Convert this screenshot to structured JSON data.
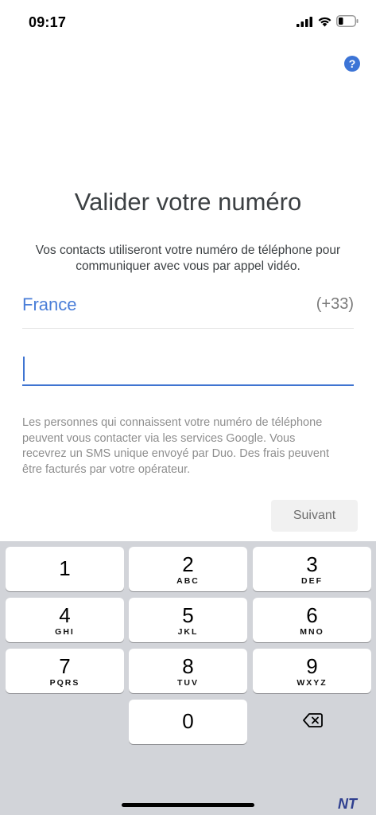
{
  "status_bar": {
    "time": "09:17",
    "icons": [
      "cellular-signal-icon",
      "wifi-icon",
      "battery-icon"
    ]
  },
  "help_icon": "help-icon",
  "title": "Valider votre numéro",
  "description": "Vos contacts utiliseront votre numéro de téléphone pour communiquer avec vous par appel vidéo.",
  "country": {
    "name": "France",
    "code": "(+33)"
  },
  "phone_input": {
    "value": "",
    "placeholder": ""
  },
  "notice": "Les personnes qui connaissent votre numéro de téléphone peuvent vous contacter via les services Google. Vous recevrez un SMS unique envoyé par Duo. Des frais peuvent être facturés par votre opérateur.",
  "next_button": "Suivant",
  "keypad": {
    "keys": [
      {
        "digit": "1",
        "letters": ""
      },
      {
        "digit": "2",
        "letters": "ABC"
      },
      {
        "digit": "3",
        "letters": "DEF"
      },
      {
        "digit": "4",
        "letters": "GHI"
      },
      {
        "digit": "5",
        "letters": "JKL"
      },
      {
        "digit": "6",
        "letters": "MNO"
      },
      {
        "digit": "7",
        "letters": "PQRS"
      },
      {
        "digit": "8",
        "letters": "TUV"
      },
      {
        "digit": "9",
        "letters": "WXYZ"
      },
      {
        "digit": "0",
        "letters": ""
      }
    ],
    "backspace_icon": "backspace-icon"
  },
  "watermark": "NT",
  "colors": {
    "accent": "#4a7ed8",
    "input_underline": "#3f74d1",
    "keypad_bg": "#d2d4d9"
  }
}
